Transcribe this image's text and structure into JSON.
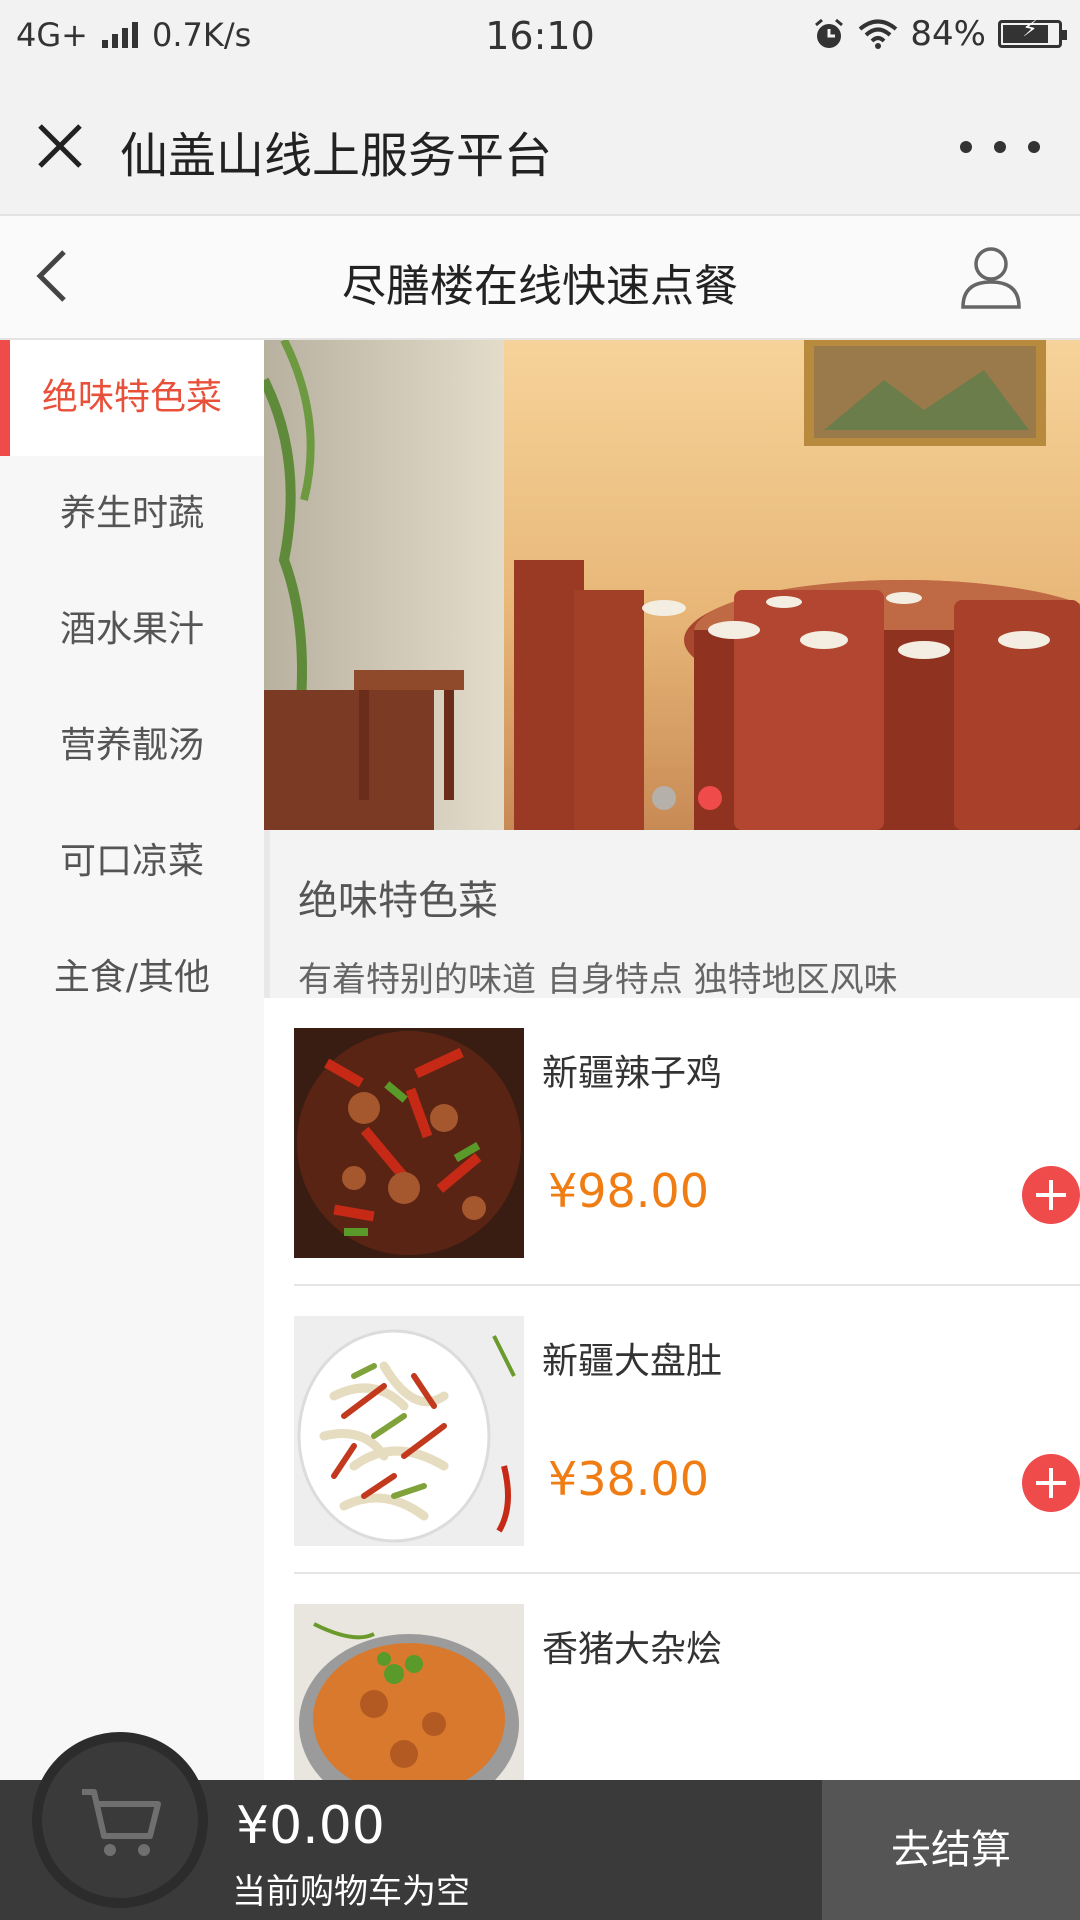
{
  "status_bar": {
    "network": "4G+",
    "speed": "0.7K/s",
    "time": "16:10",
    "battery": "84%",
    "battery_level": 0.84,
    "icons": [
      "signal-icon",
      "alarm-icon",
      "wifi-icon",
      "battery-icon"
    ]
  },
  "wechat_bar": {
    "title": "仙盖山线上服务平台",
    "icons": [
      "close-icon",
      "more-icon"
    ]
  },
  "nav": {
    "title": "尽膳楼在线快速点餐",
    "icons": [
      "back-icon",
      "user-icon"
    ]
  },
  "sidebar": {
    "items": [
      {
        "label": "绝味特色菜",
        "active": true
      },
      {
        "label": "养生时蔬",
        "active": false
      },
      {
        "label": "酒水果汁",
        "active": false
      },
      {
        "label": "营养靓汤",
        "active": false
      },
      {
        "label": "可口凉菜",
        "active": false
      },
      {
        "label": "主食/其他",
        "active": false
      }
    ]
  },
  "banner": {
    "slides": 2,
    "active_slide": 2
  },
  "category": {
    "name": "绝味特色菜",
    "description": "有着特别的味道 自身特点 独特地区风味"
  },
  "dishes": [
    {
      "name": "新疆辣子鸡",
      "price": "¥98.00"
    },
    {
      "name": "新疆大盘肚",
      "price": "¥38.00"
    },
    {
      "name": "香猪大杂烩",
      "price": ""
    }
  ],
  "cart": {
    "total": "¥0.00",
    "status": "当前购物车为空",
    "checkout_label": "去结算",
    "icon": "cart-icon"
  },
  "colors": {
    "accent": "#f04b4b",
    "price": "#f07d14",
    "active_text": "#e8503a",
    "cart_bar": "#3a3a3a",
    "checkout_bg": "#555555"
  }
}
